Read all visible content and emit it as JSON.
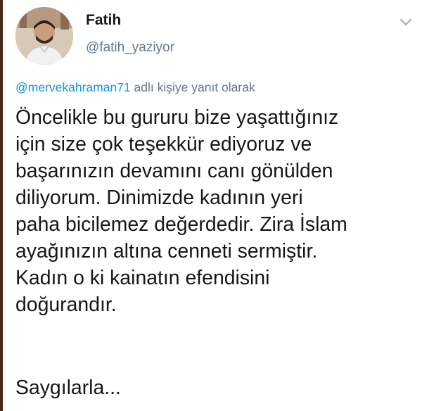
{
  "tweet": {
    "author": {
      "display_name": "Fatih",
      "username": "@fatih_yaziyor"
    },
    "reply_context": {
      "mention": "@mervekahraman71",
      "suffix": " adlı kişiye yanıt olarak"
    },
    "text_lines": [
      "Öncelikle bu gururu bize yaşattığınız",
      "için size çok teşekkür ediyoruz ve",
      "başarınızın devamını canı gönülden",
      "diliyorum. Dinimizde kadının yeri",
      "paha bicilemez değerdedir. Zira İslam",
      "ayağınızın altına cenneti sermiştir.",
      "Kadın o ki kainatın efendisini",
      "doğurandır."
    ],
    "signoff": "Saygılarla..."
  },
  "icons": {
    "menu": "chevron-down-icon",
    "avatar": "avatar"
  },
  "colors": {
    "text": "#14171a",
    "secondary": "#657786",
    "mention": "#1b95e0"
  }
}
